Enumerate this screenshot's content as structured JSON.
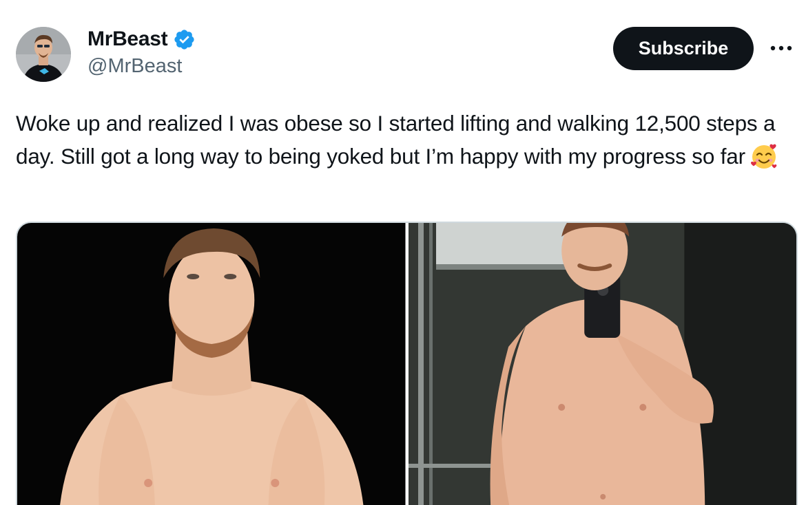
{
  "author": {
    "display_name": "MrBeast",
    "handle": "@MrBeast",
    "verified": true,
    "verified_color": "#1d9bf0"
  },
  "actions": {
    "subscribe_label": "Subscribe",
    "more_icon": "more-horizontal-icon"
  },
  "post": {
    "text": "Woke up and realized I was obese so I started lifting and walking 12,500 steps a day. Still got a long way to being yoked but I’m happy with my progress so far",
    "emoji": "smiling-face-with-hearts-emoji"
  },
  "media": {
    "photos": [
      {
        "name": "before-photo",
        "background": "#050505"
      },
      {
        "name": "after-photo",
        "background": "#3a3f3b"
      }
    ]
  },
  "colors": {
    "text_primary": "#0f1419",
    "text_secondary": "#536471",
    "border": "#cfd9de",
    "button_bg": "#0f1419"
  }
}
